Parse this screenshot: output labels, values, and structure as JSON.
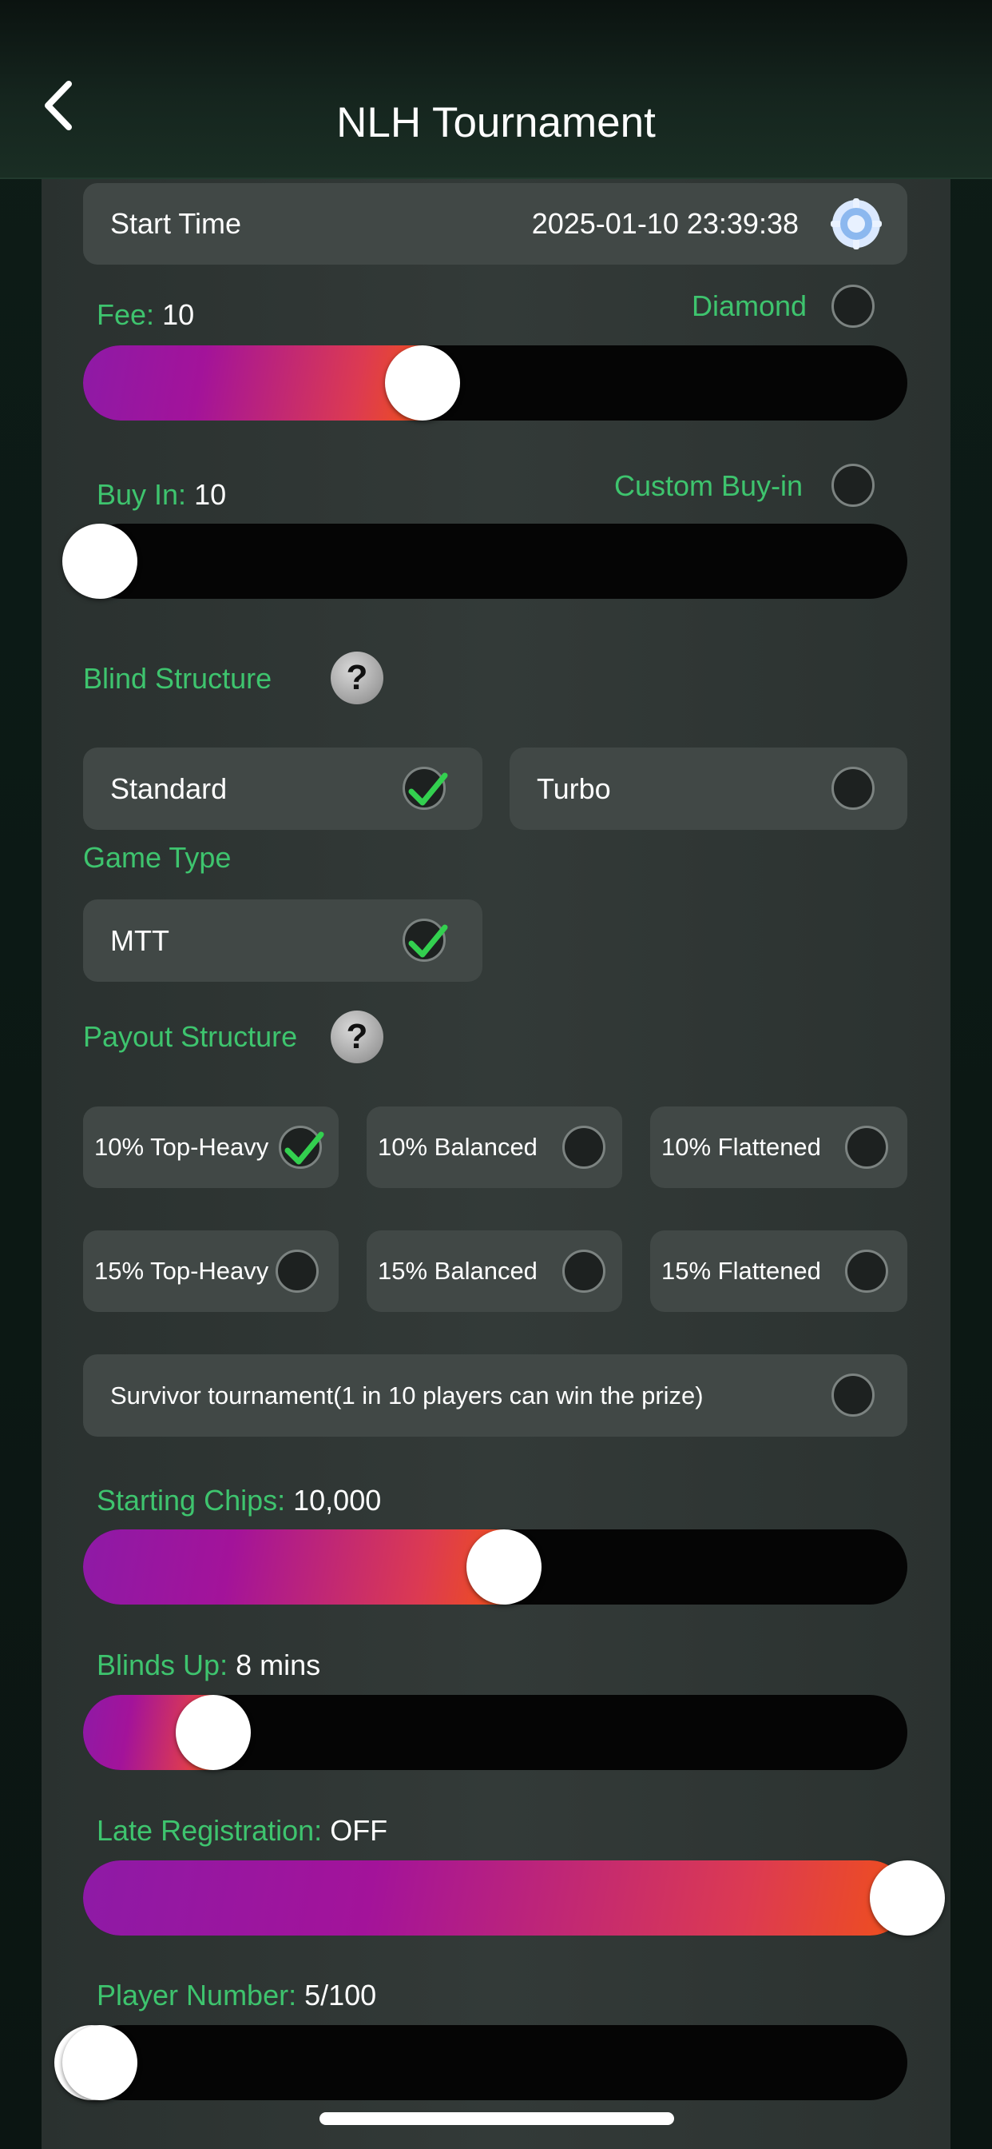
{
  "header": {
    "title": "NLH Tournament"
  },
  "start_time": {
    "label": "Start Time",
    "value": "2025-01-10 23:39:38"
  },
  "fee": {
    "label": "Fee:",
    "value": "10",
    "option_label": "Diamond",
    "option_checked": false,
    "level": 0.4
  },
  "buy_in": {
    "label": "Buy In:",
    "value": "10",
    "option_label": "Custom Buy-in",
    "option_checked": false,
    "level": 0.0
  },
  "blind_structure": {
    "label": "Blind Structure",
    "help": "?",
    "options": [
      {
        "label": "Standard",
        "checked": true
      },
      {
        "label": "Turbo",
        "checked": false
      }
    ]
  },
  "game_type": {
    "label": "Game Type",
    "options": [
      {
        "label": "MTT",
        "checked": true
      }
    ]
  },
  "payout_structure": {
    "label": "Payout Structure",
    "help": "?",
    "options": [
      {
        "label": "10% Top-Heavy",
        "checked": true
      },
      {
        "label": "10% Balanced",
        "checked": false
      },
      {
        "label": "10% Flattened",
        "checked": false
      },
      {
        "label": "15% Top-Heavy",
        "checked": false
      },
      {
        "label": "15% Balanced",
        "checked": false
      },
      {
        "label": "15% Flattened",
        "checked": false
      }
    ]
  },
  "survivor": {
    "label": "Survivor tournament(1 in 10 players can win the prize)",
    "checked": false
  },
  "starting_chips": {
    "label": "Starting Chips:",
    "value": "10,000",
    "level": 0.5
  },
  "blinds_up": {
    "label": "Blinds Up:",
    "value": "8 mins",
    "level": 0.14
  },
  "late_registration": {
    "label": "Late Registration:",
    "value": "OFF",
    "level": 1.0
  },
  "player_number": {
    "label": "Player Number:",
    "value": "5/100",
    "level": 0.0
  },
  "colors": {
    "accent_green": "#3ec46e",
    "check_green": "#33d04f",
    "slider_start": "#8e1aa6",
    "slider_end": "#f0501a"
  }
}
